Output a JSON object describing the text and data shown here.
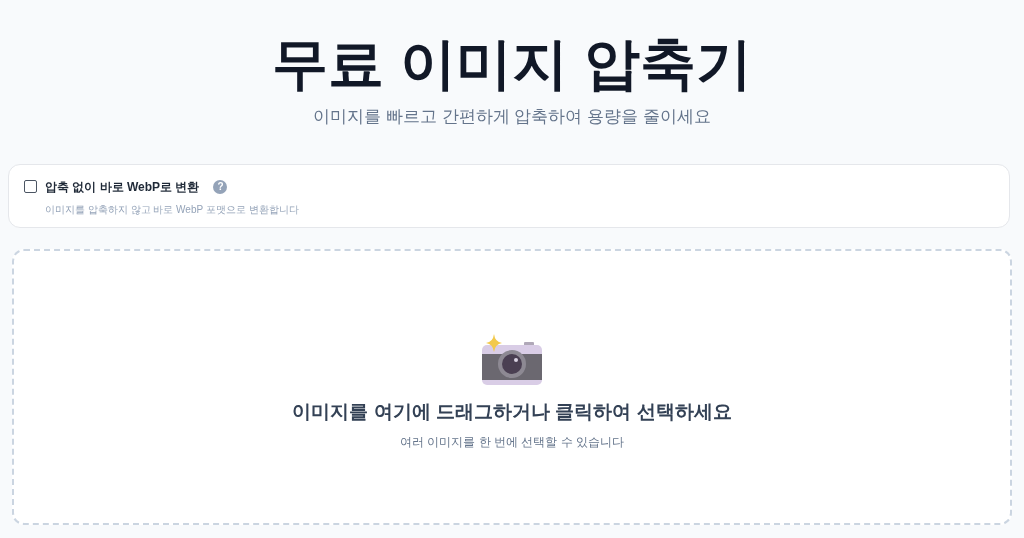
{
  "header": {
    "title": "무료 이미지 압축기",
    "subtitle": "이미지를 빠르고 간편하게 압축하여 용량을 줄이세요"
  },
  "option": {
    "label": "압축 없이 바로 WebP로 변환",
    "checked": false,
    "help": "?",
    "description": "이미지를 압축하지 않고 바로 WebP 포맷으로 변환합니다"
  },
  "dropzone": {
    "title": "이미지를 여기에 드래그하거나 클릭하여 선택하세요",
    "hint": "여러 이미지를 한 번에 선택할 수 있습니다"
  }
}
